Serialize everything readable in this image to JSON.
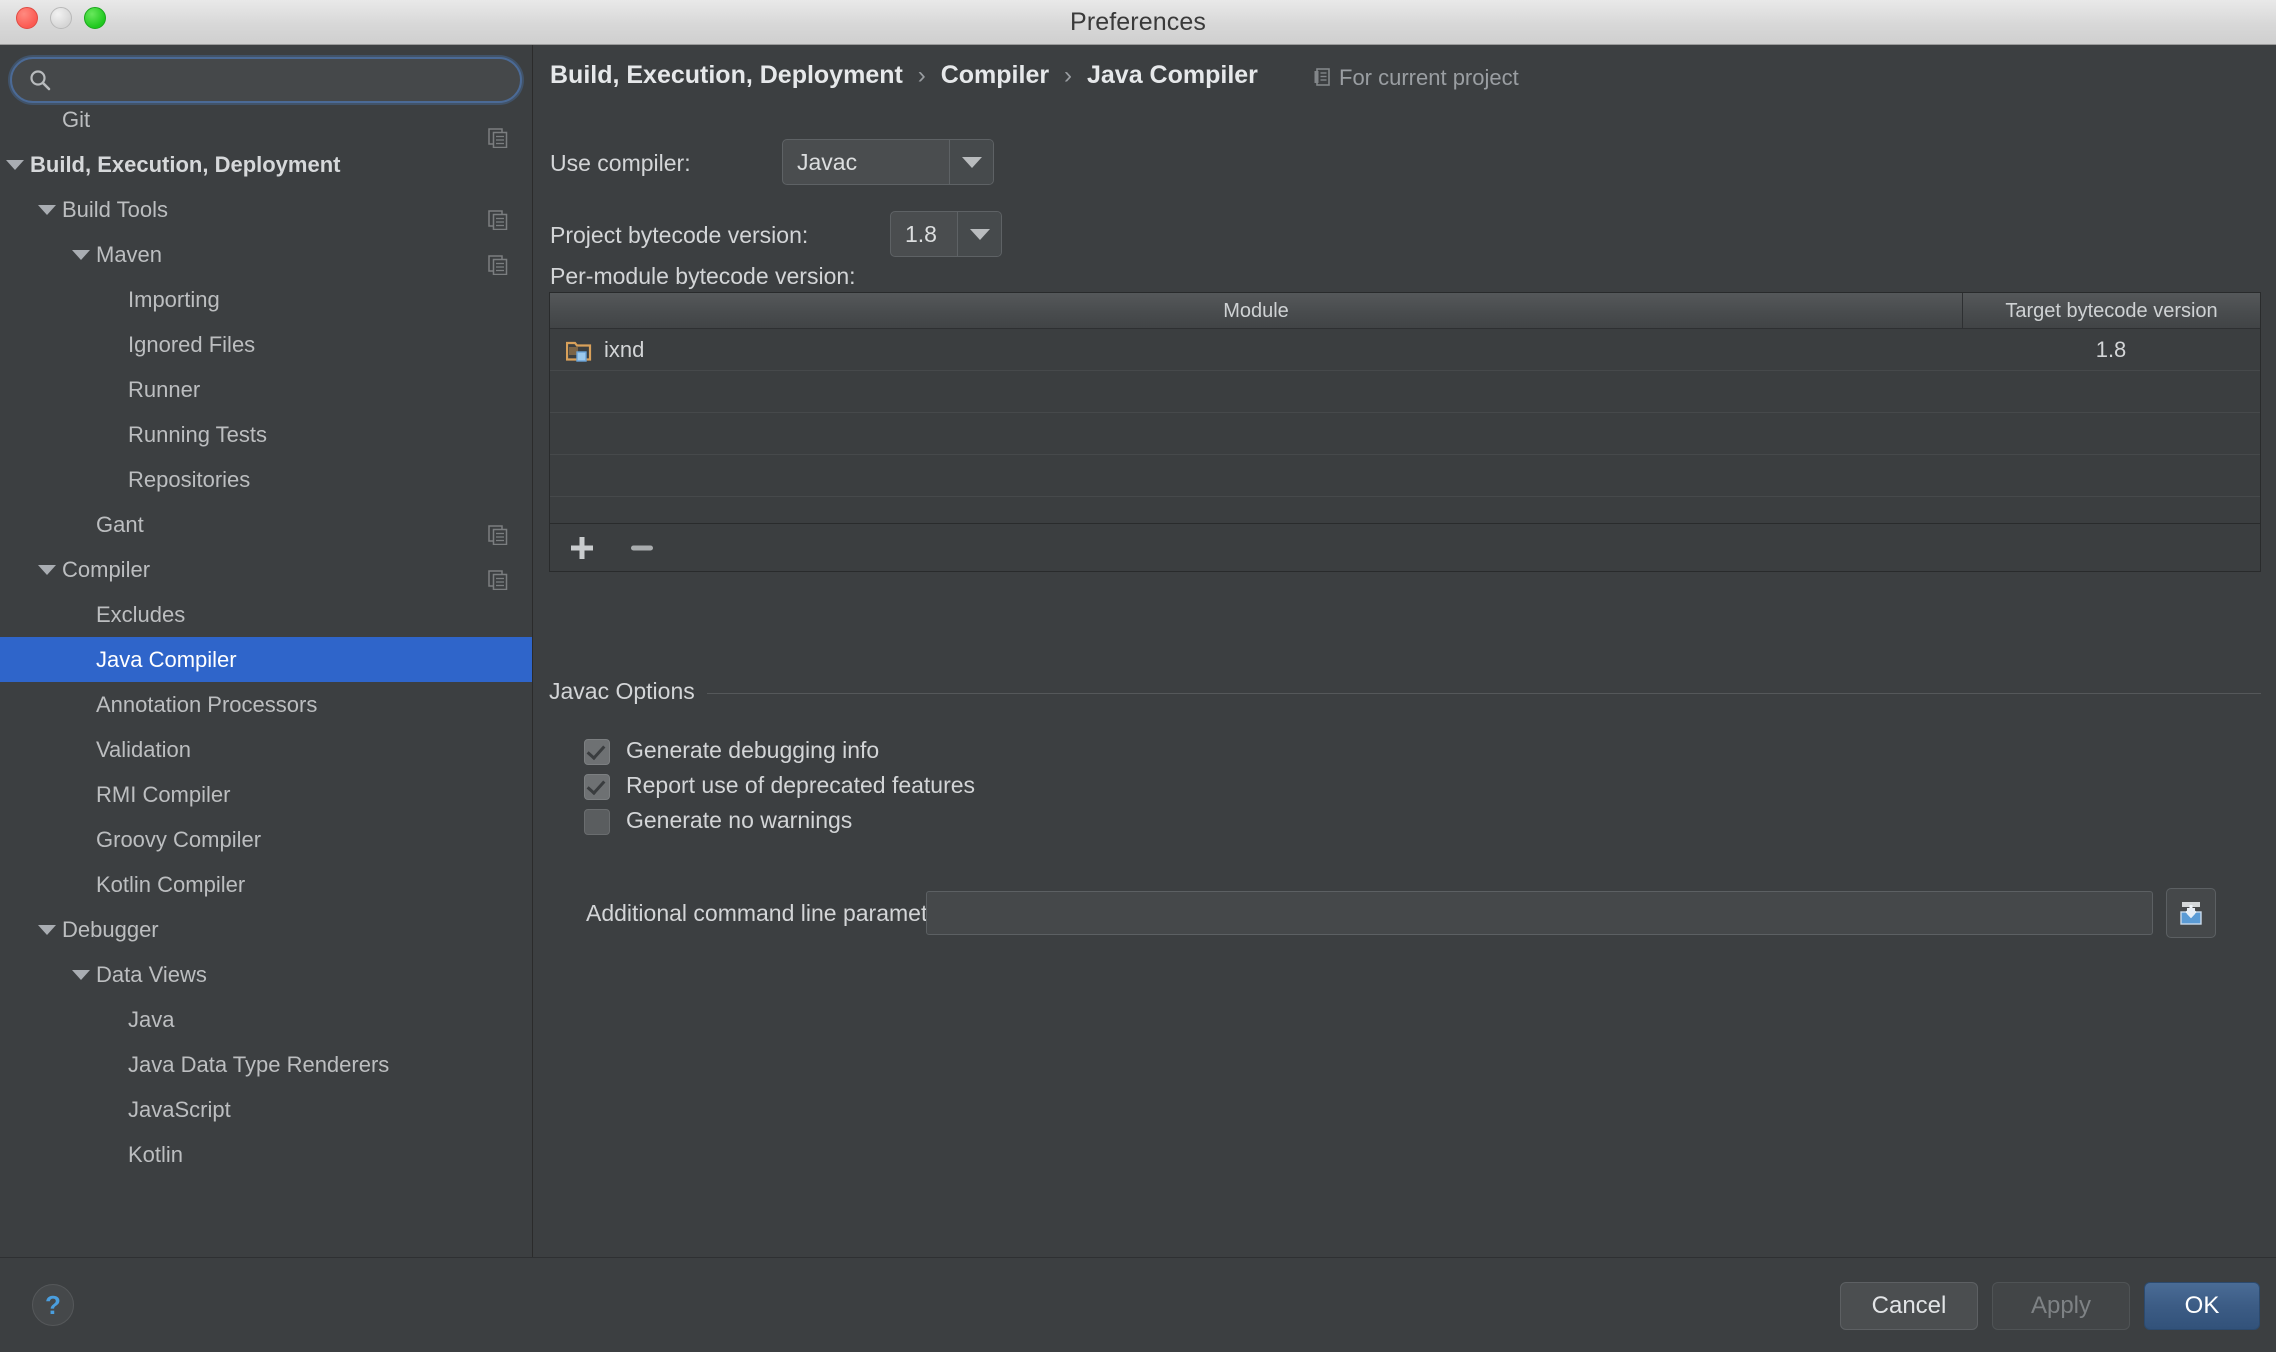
{
  "window": {
    "title": "Preferences"
  },
  "search": {
    "value": "",
    "placeholder": ""
  },
  "sidebar": {
    "items": [
      {
        "label": "Git",
        "indent": 1,
        "arrow": "none",
        "bold": false,
        "selected": false,
        "copy_icon": true,
        "clipped": true
      },
      {
        "label": "Build, Execution, Deployment",
        "indent": 0,
        "arrow": "down",
        "bold": true,
        "selected": false,
        "copy_icon": false,
        "clipped": false
      },
      {
        "label": "Build Tools",
        "indent": 1,
        "arrow": "down",
        "bold": false,
        "selected": false,
        "copy_icon": true,
        "clipped": false
      },
      {
        "label": "Maven",
        "indent": 2,
        "arrow": "down",
        "bold": false,
        "selected": false,
        "copy_icon": true,
        "clipped": false
      },
      {
        "label": "Importing",
        "indent": 3,
        "arrow": "none",
        "bold": false,
        "selected": false,
        "copy_icon": false,
        "clipped": false
      },
      {
        "label": "Ignored Files",
        "indent": 3,
        "arrow": "none",
        "bold": false,
        "selected": false,
        "copy_icon": false,
        "clipped": false
      },
      {
        "label": "Runner",
        "indent": 3,
        "arrow": "none",
        "bold": false,
        "selected": false,
        "copy_icon": false,
        "clipped": false
      },
      {
        "label": "Running Tests",
        "indent": 3,
        "arrow": "none",
        "bold": false,
        "selected": false,
        "copy_icon": false,
        "clipped": false
      },
      {
        "label": "Repositories",
        "indent": 3,
        "arrow": "none",
        "bold": false,
        "selected": false,
        "copy_icon": false,
        "clipped": false
      },
      {
        "label": "Gant",
        "indent": 2,
        "arrow": "none",
        "bold": false,
        "selected": false,
        "copy_icon": true,
        "clipped": false
      },
      {
        "label": "Compiler",
        "indent": 1,
        "arrow": "down",
        "bold": false,
        "selected": false,
        "copy_icon": true,
        "clipped": false
      },
      {
        "label": "Excludes",
        "indent": 2,
        "arrow": "none",
        "bold": false,
        "selected": false,
        "copy_icon": false,
        "clipped": false
      },
      {
        "label": "Java Compiler",
        "indent": 2,
        "arrow": "none",
        "bold": false,
        "selected": true,
        "copy_icon": false,
        "clipped": false
      },
      {
        "label": "Annotation Processors",
        "indent": 2,
        "arrow": "none",
        "bold": false,
        "selected": false,
        "copy_icon": false,
        "clipped": false
      },
      {
        "label": "Validation",
        "indent": 2,
        "arrow": "none",
        "bold": false,
        "selected": false,
        "copy_icon": false,
        "clipped": false
      },
      {
        "label": "RMI Compiler",
        "indent": 2,
        "arrow": "none",
        "bold": false,
        "selected": false,
        "copy_icon": false,
        "clipped": false
      },
      {
        "label": "Groovy Compiler",
        "indent": 2,
        "arrow": "none",
        "bold": false,
        "selected": false,
        "copy_icon": false,
        "clipped": false
      },
      {
        "label": "Kotlin Compiler",
        "indent": 2,
        "arrow": "none",
        "bold": false,
        "selected": false,
        "copy_icon": false,
        "clipped": false
      },
      {
        "label": "Debugger",
        "indent": 1,
        "arrow": "down",
        "bold": false,
        "selected": false,
        "copy_icon": false,
        "clipped": false
      },
      {
        "label": "Data Views",
        "indent": 2,
        "arrow": "down",
        "bold": false,
        "selected": false,
        "copy_icon": false,
        "clipped": false
      },
      {
        "label": "Java",
        "indent": 3,
        "arrow": "none",
        "bold": false,
        "selected": false,
        "copy_icon": false,
        "clipped": false
      },
      {
        "label": "Java Data Type Renderers",
        "indent": 3,
        "arrow": "none",
        "bold": false,
        "selected": false,
        "copy_icon": false,
        "clipped": false
      },
      {
        "label": "JavaScript",
        "indent": 3,
        "arrow": "none",
        "bold": false,
        "selected": false,
        "copy_icon": false,
        "clipped": false
      },
      {
        "label": "Kotlin",
        "indent": 3,
        "arrow": "none",
        "bold": false,
        "selected": false,
        "copy_icon": false,
        "clipped": false
      }
    ]
  },
  "main": {
    "breadcrumb": {
      "part1": "Build, Execution, Deployment",
      "sep1": "›",
      "part2": "Compiler",
      "sep2": "›",
      "part3": "Java Compiler"
    },
    "scope_label": "For current project",
    "use_compiler": {
      "label": "Use compiler:",
      "value": "Javac"
    },
    "project_bytecode": {
      "label": "Project bytecode version:",
      "value": "1.8"
    },
    "per_module": {
      "label": "Per-module bytecode version:",
      "columns": [
        "Module",
        "Target bytecode version"
      ],
      "rows": [
        {
          "module": "ixnd",
          "target": "1.8"
        }
      ],
      "add_label": "+",
      "remove_label": "−"
    },
    "javac_options": {
      "legend": "Javac Options",
      "checkboxes": [
        {
          "label": "Generate debugging info",
          "checked": true
        },
        {
          "label": "Report use of deprecated features",
          "checked": true
        },
        {
          "label": "Generate no warnings",
          "checked": false
        }
      ],
      "additional_params": {
        "label": "Additional command line parameters:",
        "value": "",
        "placeholder": ""
      }
    }
  },
  "bottom": {
    "help_label": "?",
    "cancel_label": "Cancel",
    "apply_label": "Apply",
    "ok_label": "OK"
  },
  "colors": {
    "accent_selection": "#2f65ca",
    "annotation_red": "#fc2b20",
    "ok_button_blue": "#3c5c85",
    "panel_bg": "#3c3f41"
  }
}
